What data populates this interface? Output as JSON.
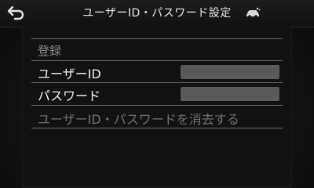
{
  "header": {
    "title": "ユーザーID・パスワード設定",
    "back_icon": "back-arrow-icon",
    "status_icon": "car-icon"
  },
  "form": {
    "section_label": "登録",
    "user_id": {
      "label": "ユーザーID",
      "value": ""
    },
    "password": {
      "label": "パスワード",
      "value": ""
    },
    "delete_label": "ユーザーID・パスワードを消去する"
  },
  "colors": {
    "background": "#141414",
    "divider": "#6a6a6a",
    "field": "#5a5a5a",
    "disabled_text": "#6f6f6f"
  }
}
